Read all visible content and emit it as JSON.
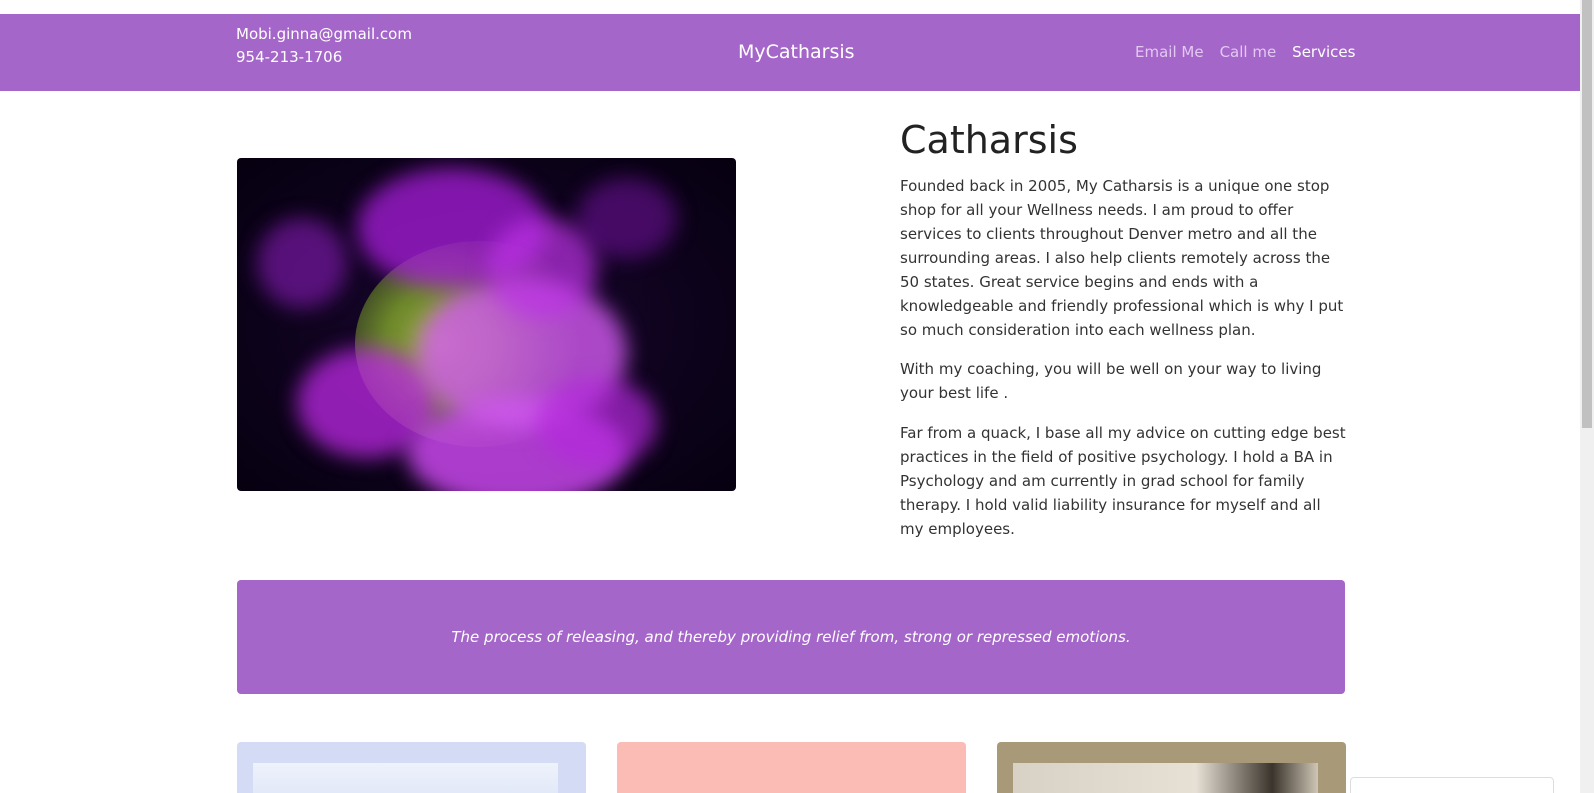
{
  "navbar": {
    "email": "Mobi.ginna@gmail.com",
    "phone": "954-213-1706",
    "brand": "MyCatharsis",
    "links": [
      {
        "label": "Email Me"
      },
      {
        "label": "Call me"
      },
      {
        "label": "Services"
      }
    ]
  },
  "about": {
    "title": "Catharsis",
    "paragraphs": [
      "Founded back in 2005, My Catharsis is a unique one stop shop for all your Wellness needs. I am proud to offer services to clients throughout Denver metro and all the surrounding areas. I also help clients remotely across the 50 states. Great service begins and ends with a knowledgeable and friendly professional which is why I put so much consideration into each wellness plan.",
      "With my coaching, you will be well on your way to living your best life .",
      "Far from a quack, I base all my advice on cutting edge best practices in the field of positive psychology. I hold a BA in Psychology and am currently in grad school for family therapy. I hold valid liability insurance for myself and all my employees."
    ]
  },
  "quote": {
    "text": "The process of releasing, and thereby providing relief from, strong or repressed emotions."
  },
  "colors": {
    "accent": "#a466c8",
    "card_1": "#d4dcf5",
    "card_2": "#fcbcb6",
    "card_3": "#a89a78"
  }
}
